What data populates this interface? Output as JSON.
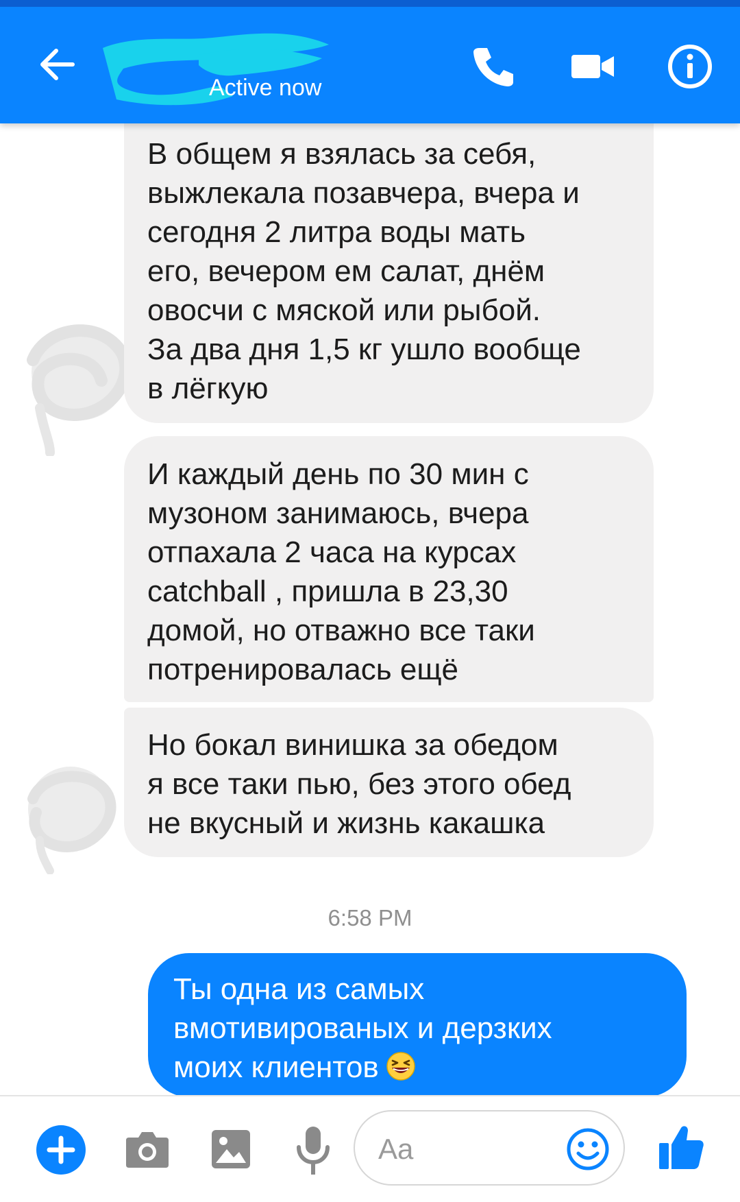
{
  "header": {
    "contact_status": "Active now",
    "back_icon": "arrow-left-icon",
    "call_icon": "phone-icon",
    "video_icon": "video-camera-icon",
    "info_icon": "info-icon",
    "accent_color": "#0a84ff"
  },
  "messages": [
    {
      "direction": "received",
      "lines": [
        "В общем я взялась за себя,",
        "выжлекала позавчера, вчера и",
        "сегодня 2 литра воды мать",
        "его, вечером ем салат, днём",
        "овосчи с мяской или рыбой.",
        "За два дня 1,5 кг ушло вообще",
        "в лёгкую"
      ]
    },
    {
      "direction": "received",
      "lines": [
        "И каждый день по 30 мин с",
        "музоном занимаюсь, вчера",
        "отпахала 2 часа на курсах",
        "catchball , пришла в 23,30",
        "домой, но отважно все таки",
        "потренировалась ещё"
      ]
    },
    {
      "direction": "received",
      "lines": [
        "Но бокал винишка за обедом",
        "я все таки пью, без этого обед",
        "не вкусный и жизнь какашка"
      ]
    }
  ],
  "timestamp": "6:58 PM",
  "sent_message": {
    "direction": "sent",
    "lines": [
      "Ты одна из самых",
      "вмотивированых и дерзких",
      "моих клиентов"
    ],
    "emoji": "grinning-squinting-face-emoji"
  },
  "composer": {
    "placeholder": "Aa",
    "plus_icon": "plus-icon",
    "camera_icon": "camera-icon",
    "gallery_icon": "image-icon",
    "mic_icon": "microphone-icon",
    "emoji_icon": "smiley-icon",
    "like_icon": "thumbs-up-icon"
  }
}
